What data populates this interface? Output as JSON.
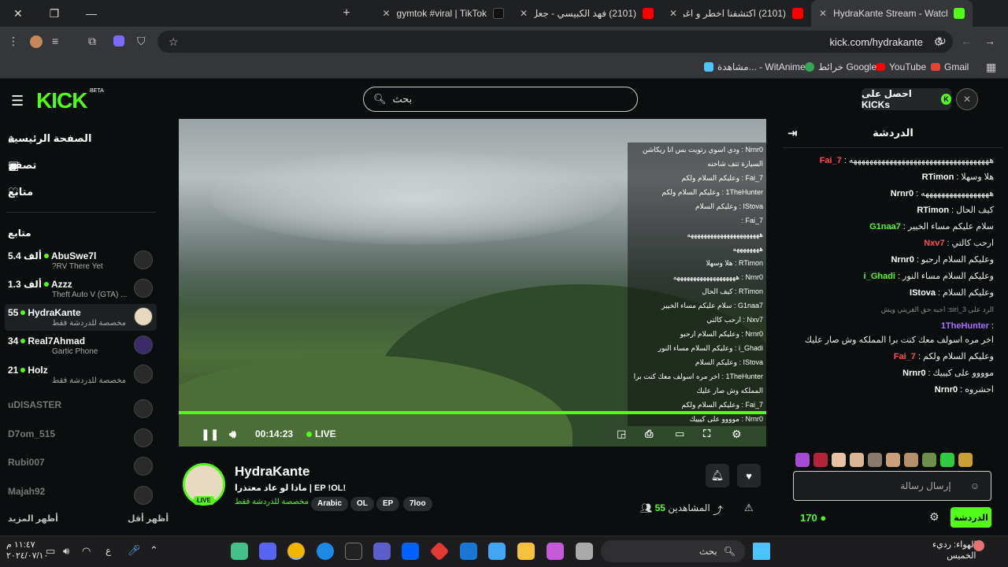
{
  "browser": {
    "tabs": [
      {
        "title": "gymtok #viral | TikTok",
        "icon": "tiktok-icon"
      },
      {
        "title": "(2101) فهد الكبيسي - جعل السحاب",
        "icon": "youtube-icon"
      },
      {
        "title": "(2101) اكتشفنا اخطر و اغرب اماك",
        "icon": "youtube-icon"
      },
      {
        "title": "HydraKante Stream - Watch Live",
        "icon": "kick-icon"
      }
    ],
    "url": "kick.com/hydrakante",
    "bookmarks": [
      "Gmail",
      "YouTube",
      "خرائط Google",
      "مشاهدة... - WitAnime"
    ]
  },
  "header": {
    "logo": "KICK",
    "beta": "BETA",
    "search_placeholder": "بحث",
    "kicks_label": "احصل على KICKs"
  },
  "sidebar": {
    "nav": [
      {
        "label": "الصفحة الرئيسية",
        "icon": "home-icon"
      },
      {
        "label": "تصفح",
        "icon": "browse-icon"
      },
      {
        "label": "متابع",
        "icon": "heart-icon"
      }
    ],
    "following_header": "متابع",
    "channels": [
      {
        "count": "5.4 ألف",
        "name": "AbuSwe7l",
        "sub": "?RV There Yet",
        "live": true
      },
      {
        "count": "1.3 ألف",
        "name": "Azzz",
        "sub": "Theft Auto V (GTA) ...",
        "live": true
      },
      {
        "count": "55",
        "name": "HydraKante",
        "sub": "مخصصة للدردشة فقط",
        "live": true,
        "selected": true
      },
      {
        "count": "34",
        "name": "Real7Ahmad",
        "sub": "Gartic Phone",
        "live": true
      },
      {
        "count": "21",
        "name": "Holz",
        "sub": "مخصصة للدردشة فقط",
        "live": true
      },
      {
        "count": "",
        "name": "uDISASTER",
        "sub": "",
        "live": false
      },
      {
        "count": "",
        "name": "D7om_515",
        "sub": "",
        "live": false
      },
      {
        "count": "",
        "name": "Rubi007",
        "sub": "",
        "live": false
      },
      {
        "count": "",
        "name": "Majah92",
        "sub": "",
        "live": false
      }
    ],
    "show_more": "أظهر المزيد",
    "show_less": "أظهر أقل"
  },
  "player": {
    "time": "00:14:23",
    "live": "LIVE",
    "progress": 1.0,
    "overlay_chat": [
      "Nrnr0 : ودي اسوي رتويت بس انا ريكاشن",
      "السيارة تتف شاحنه",
      "Fai_7 : وعليكم السلام ولكم",
      "1TheHunter : وعليكم السلام ولكم",
      "IStova : وعليكم السلام",
      "Fai_7 :",
      "ههههههههههههههههههههههه",
      "ههههههههه",
      "RTimon : هلا وسهلا",
      "Nrnr0 : هههههههههههههههههههه",
      "RTimon : كيف الحال",
      "G1naa7 : سلام عليكم مساء الخيير",
      "Nxv7 : ارحب كالتي",
      "Nrnr0 : وعليكم السلام ارحبو",
      "i_Ghadi : وعليكم السلام مساء النور",
      "IStova : وعليكم السلام",
      "1TheHunter : اخر مره اسولف معك كنت برا",
      "المملكه وش صار عليك",
      "Fai_7 : وعليكم السلام ولكم",
      "Nrnr0 : موووو على كيييك",
      "Nrnr0 : احشروه"
    ]
  },
  "stream": {
    "name": "HydraKante",
    "title": "ماذا لو عاد معتذرا | EP !OL!",
    "category": "مخصصة للدردشة فقط",
    "tags": [
      "Arabic",
      "OL",
      "EP",
      "7loo"
    ],
    "viewers_label": "المشاهدين",
    "viewers": "55",
    "live_badge": "LIVE"
  },
  "chat": {
    "title": "الدردشة",
    "messages": [
      {
        "user": "Fai_7",
        "color": "#ff4d4d",
        "text": "هههههههههههههههههههههههههههههههههههه"
      },
      {
        "user": "RTimon",
        "color": "#ffffff",
        "text": "هلا وسهلا"
      },
      {
        "user": "Nrnr0",
        "color": "#ffffff",
        "text": "هههههههههههههههههه"
      },
      {
        "user": "RTimon",
        "color": "#ffffff",
        "text": "كيف الحال"
      },
      {
        "user": "G1naa7",
        "color": "#53fc18",
        "text": "سلام عليكم مساء الخيير"
      },
      {
        "user": "Nxv7",
        "color": "#ff4d4d",
        "text": "ارحب كالتي"
      },
      {
        "user": "Nrnr0",
        "color": "#ffffff",
        "text": "وعليكم السلام ارحبو"
      },
      {
        "user": "i_Ghadi",
        "color": "#53fc18",
        "text": "وعليكم السلام مساء النور"
      },
      {
        "user": "IStova",
        "color": "#ffffff",
        "text": "وعليكم السلام"
      },
      {
        "user": "1TheHunter",
        "color": "#a970ff",
        "text": "اخر مره اسولف معك كنت برا المملكه وش صار عليك"
      },
      {
        "user": "Fai_7",
        "color": "#ff4d4d",
        "text": "وعليكم السلام ولكم"
      },
      {
        "user": "Nrnr0",
        "color": "#ffffff",
        "text": "موووو على كيييك"
      },
      {
        "user": "Nrnr0",
        "color": "#ffffff",
        "text": "احشروه"
      }
    ],
    "reply_hint": "الرد على 3_siri: احبه حق الغريني ويش",
    "input_placeholder": "إرسال رسالة",
    "kicks_count": "170",
    "send_label": "الدردشة"
  },
  "taskbar": {
    "search": "بحث",
    "time": "١١:٤٧ م",
    "date": "٢٠٢٤/٠٧/١٠",
    "weather_title": "الهواء: رديء",
    "weather_sub": "الخميس",
    "lang": "ع"
  },
  "colors": {
    "accent": "#53fc18",
    "bg": "#0b0e0f"
  }
}
